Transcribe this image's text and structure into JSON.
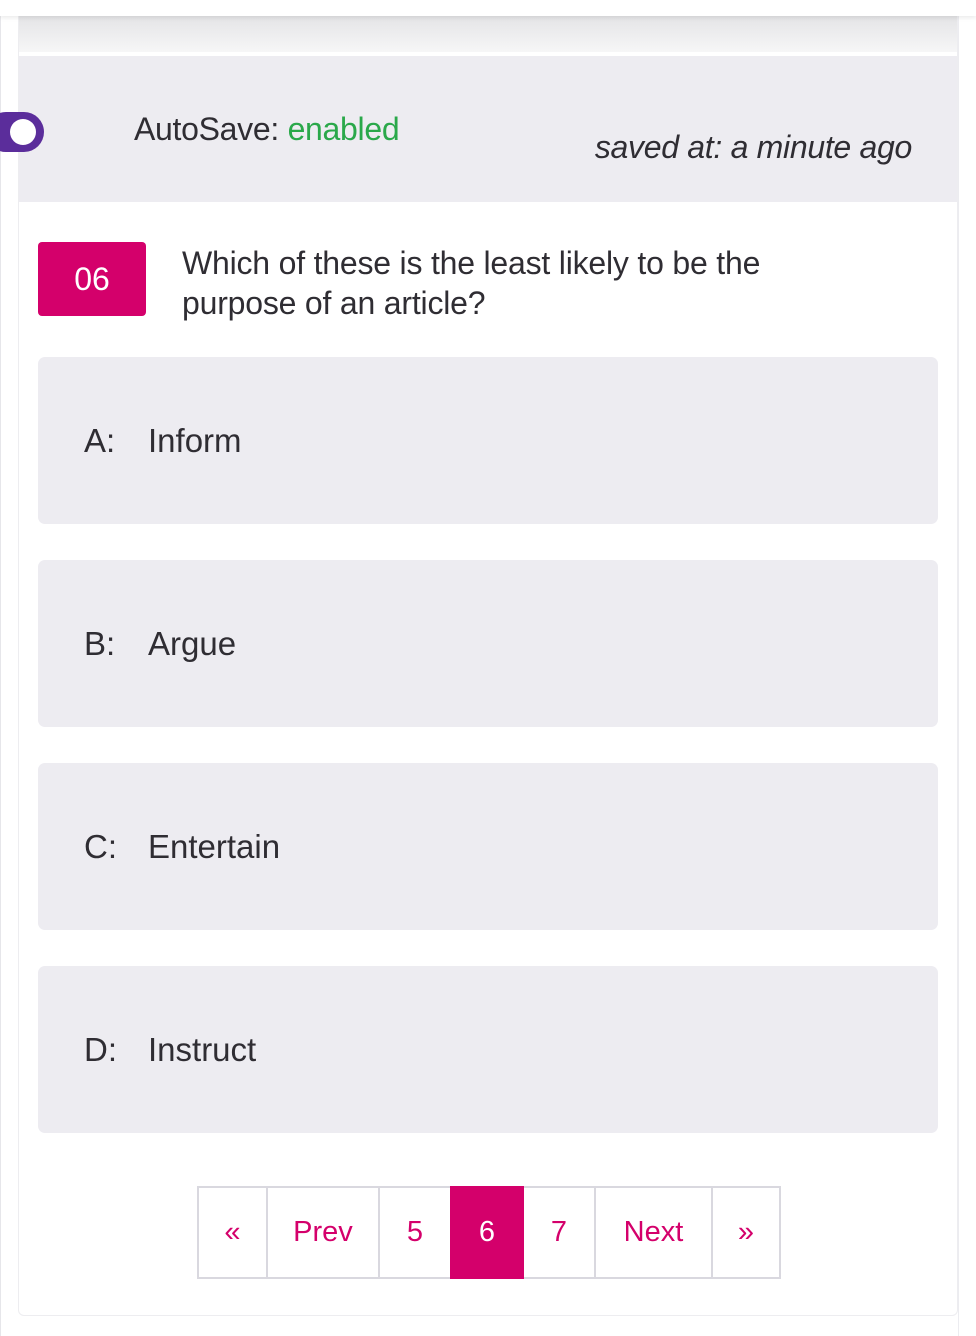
{
  "autosave": {
    "label": "AutoSave:",
    "status": "enabled",
    "toggle_on": true,
    "saved_at": "saved at: a minute ago",
    "status_color": "#2aa84a",
    "toggle_color": "#5b2d9b"
  },
  "question": {
    "number": "06",
    "text": "Which of these is the least likely to be the purpose of an article?",
    "accent_color": "#d4006b"
  },
  "options": [
    {
      "letter": "A:",
      "text": "Inform"
    },
    {
      "letter": "B:",
      "text": "Argue"
    },
    {
      "letter": "C:",
      "text": "Entertain"
    },
    {
      "letter": "D:",
      "text": "Instruct"
    }
  ],
  "pagination": {
    "first": "«",
    "prev": "Prev",
    "pages": [
      "5",
      "6",
      "7"
    ],
    "current": "6",
    "next": "Next",
    "last": "»"
  }
}
